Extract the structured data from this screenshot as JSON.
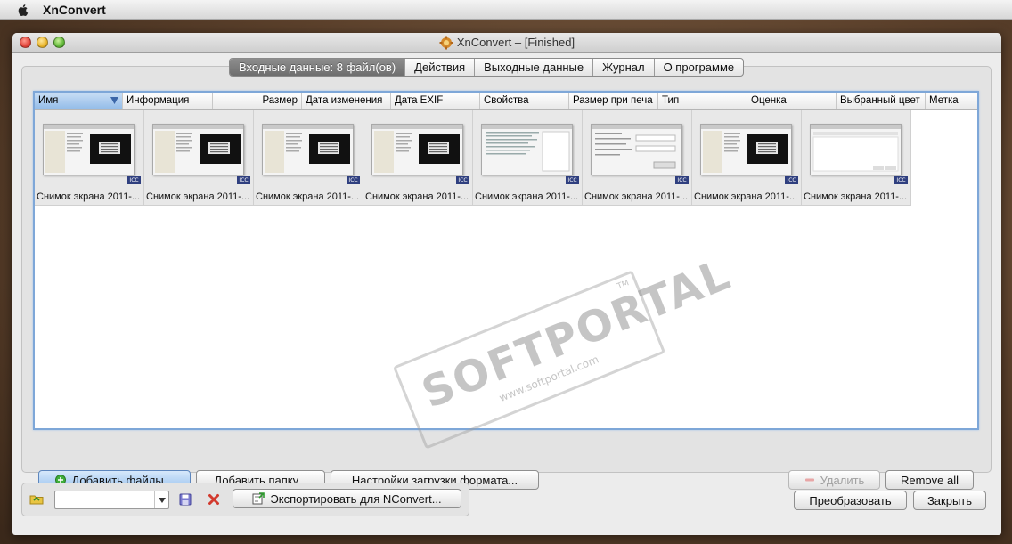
{
  "menubar": {
    "app_name": "XnConvert"
  },
  "window": {
    "title": "XnConvert – [Finished]"
  },
  "tabs": [
    {
      "label": "Входные данные: 8 файл(ов)",
      "active": true
    },
    {
      "label": "Действия",
      "active": false
    },
    {
      "label": "Выходные данные",
      "active": false
    },
    {
      "label": "Журнал",
      "active": false
    },
    {
      "label": "О программе",
      "active": false
    }
  ],
  "columns": [
    {
      "label": "Имя",
      "sorted": true
    },
    {
      "label": "Информация"
    },
    {
      "label": "Размер"
    },
    {
      "label": "Дата изменения"
    },
    {
      "label": "Дата EXIF"
    },
    {
      "label": "Свойства"
    },
    {
      "label": "Размер при печа"
    },
    {
      "label": "Тип"
    },
    {
      "label": "Оценка"
    },
    {
      "label": "Выбранный цвет"
    },
    {
      "label": "Метка"
    }
  ],
  "files": [
    {
      "label": "Снимок экрана 2011-...",
      "badge": "ICC",
      "variant": "dark"
    },
    {
      "label": "Снимок экрана 2011-...",
      "badge": "ICC",
      "variant": "dark"
    },
    {
      "label": "Снимок экрана 2011-...",
      "badge": "ICC",
      "variant": "dark"
    },
    {
      "label": "Снимок экрана 2011-...",
      "badge": "ICC",
      "variant": "dark"
    },
    {
      "label": "Снимок экрана 2011-...",
      "badge": "ICC",
      "variant": "light"
    },
    {
      "label": "Снимок экрана 2011-...",
      "badge": "ICC",
      "variant": "form"
    },
    {
      "label": "Снимок экрана 2011-...",
      "badge": "ICC",
      "variant": "dark"
    },
    {
      "label": "Снимок экрана 2011-...",
      "badge": "ICC",
      "variant": "blank"
    }
  ],
  "watermark": {
    "brand": "SOFTPORTAL",
    "url": "www.softportal.com",
    "tm": "TM"
  },
  "buttons": {
    "add_files": "Добавить файлы...",
    "add_folder": "Добавить папку...",
    "load_settings": "Настройки загрузки формата...",
    "remove": "Удалить",
    "remove_all": "Remove all",
    "export": "Экспортировать для NConvert...",
    "convert": "Преобразовать",
    "close": "Закрыть"
  },
  "preset": {
    "value": ""
  },
  "colors": {
    "accent": "#7ea7d8",
    "tab_active": "#7a7a7a"
  }
}
